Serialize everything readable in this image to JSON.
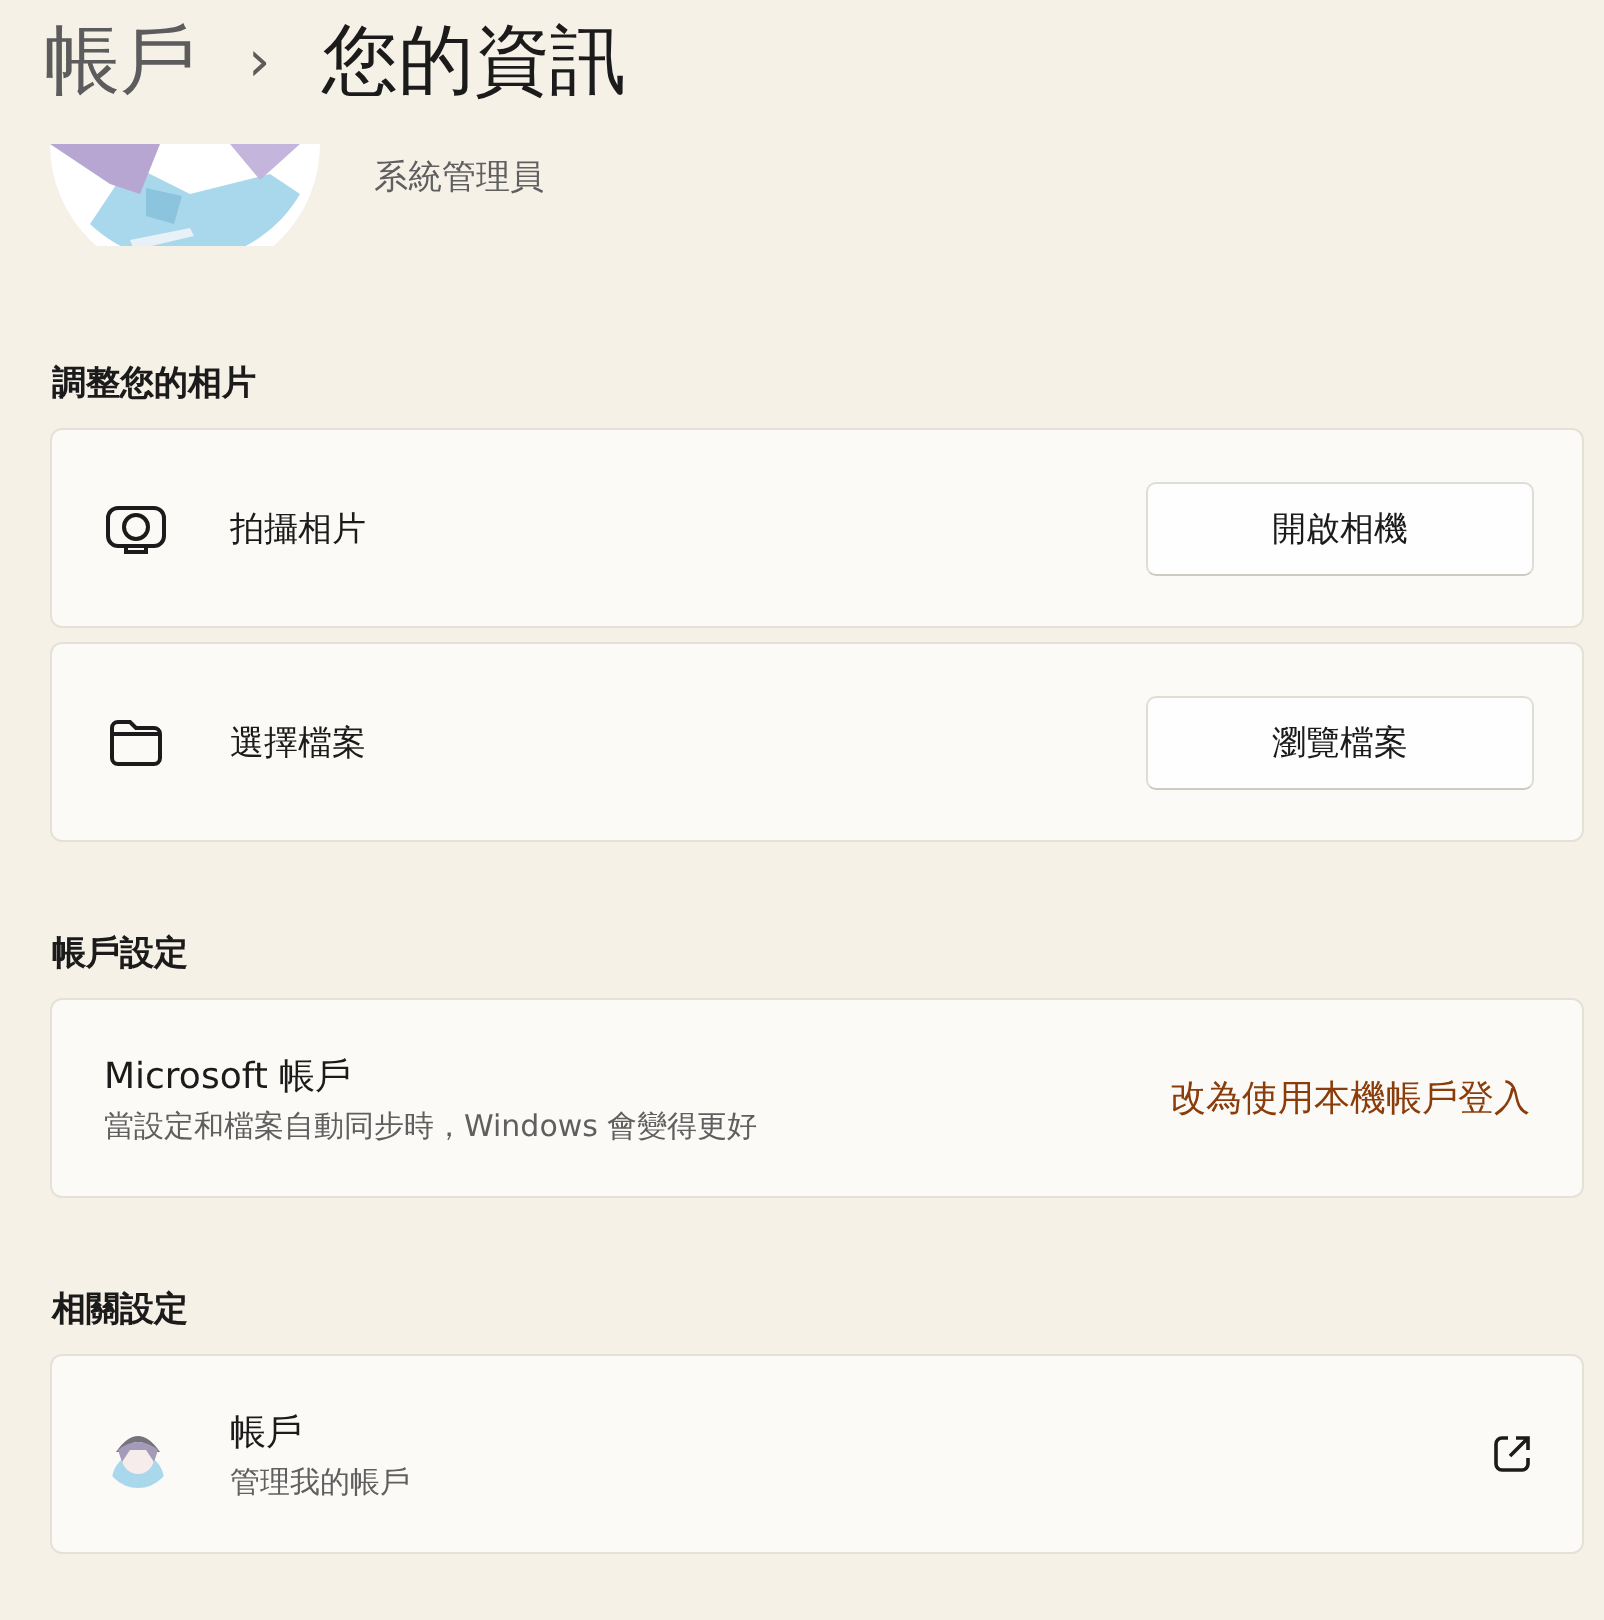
{
  "breadcrumb": {
    "parent": "帳戶",
    "separator": "›",
    "current": "您的資訊"
  },
  "profile": {
    "role": "系統管理員"
  },
  "sections": [
    {
      "title": "調整您的相片",
      "cards": [
        {
          "kind": "action",
          "label": "拍攝相片",
          "button": "開啟相機"
        },
        {
          "kind": "action",
          "label": "選擇檔案",
          "button": "瀏覽檔案"
        }
      ]
    },
    {
      "title": "帳戶設定",
      "cards": [
        {
          "kind": "link-action",
          "title": "Microsoft 帳戶",
          "subtitle": "當設定和檔案自動同步時，Windows 會變得更好",
          "link": "改為使用本機帳戶登入"
        }
      ]
    },
    {
      "title": "相關設定",
      "cards": [
        {
          "kind": "external",
          "title": "帳戶",
          "subtitle": "管理我的帳戶"
        }
      ]
    }
  ]
}
